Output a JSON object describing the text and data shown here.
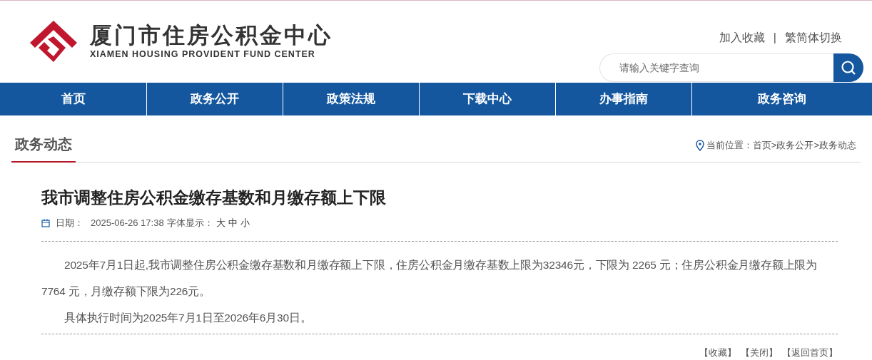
{
  "header": {
    "title": "厦门市住房公积金中心",
    "subtitle": "XIAMEN HOUSING PROVIDENT FUND CENTER",
    "links": [
      "加入收藏",
      "繁简体切换"
    ],
    "separator": "|",
    "search": {
      "placeholder": "请输入关键字查询"
    }
  },
  "nav": [
    {
      "label": "首页",
      "selected": false
    },
    {
      "label": "政务公开",
      "selected": false
    },
    {
      "label": "政策法规",
      "selected": false
    },
    {
      "label": "下载中心",
      "selected": false
    },
    {
      "label": "办事指南",
      "selected": false
    },
    {
      "label": "政务咨询",
      "selected": false
    }
  ],
  "section": {
    "title": "政务动态",
    "breadcrumb": {
      "label": "当前位置：",
      "items": [
        "首页",
        "政务公开",
        "政务动态"
      ],
      "separator": ">"
    }
  },
  "article": {
    "title": "我市调整住房公积金缴存基数和月缴存额上下限",
    "date_label": "日期：",
    "date": "2025-06-26 17:38",
    "font_label": "字体显示：",
    "font_sizes": [
      "大",
      "中",
      "小"
    ],
    "paragraphs": [
      "2025年7月1日起,我市调整住房公积金缴存基数和月缴存额上下限，住房公积金月缴存基数上限为32346元，下限为 2265 元；住房公积金月缴存额上限为7764 元，月缴存额下限为226元。",
      "具体执行时间为2025年7月1日至2026年6月30日。"
    ],
    "actions": [
      "【收藏】",
      "【关闭】",
      "【返回首页】"
    ]
  }
}
